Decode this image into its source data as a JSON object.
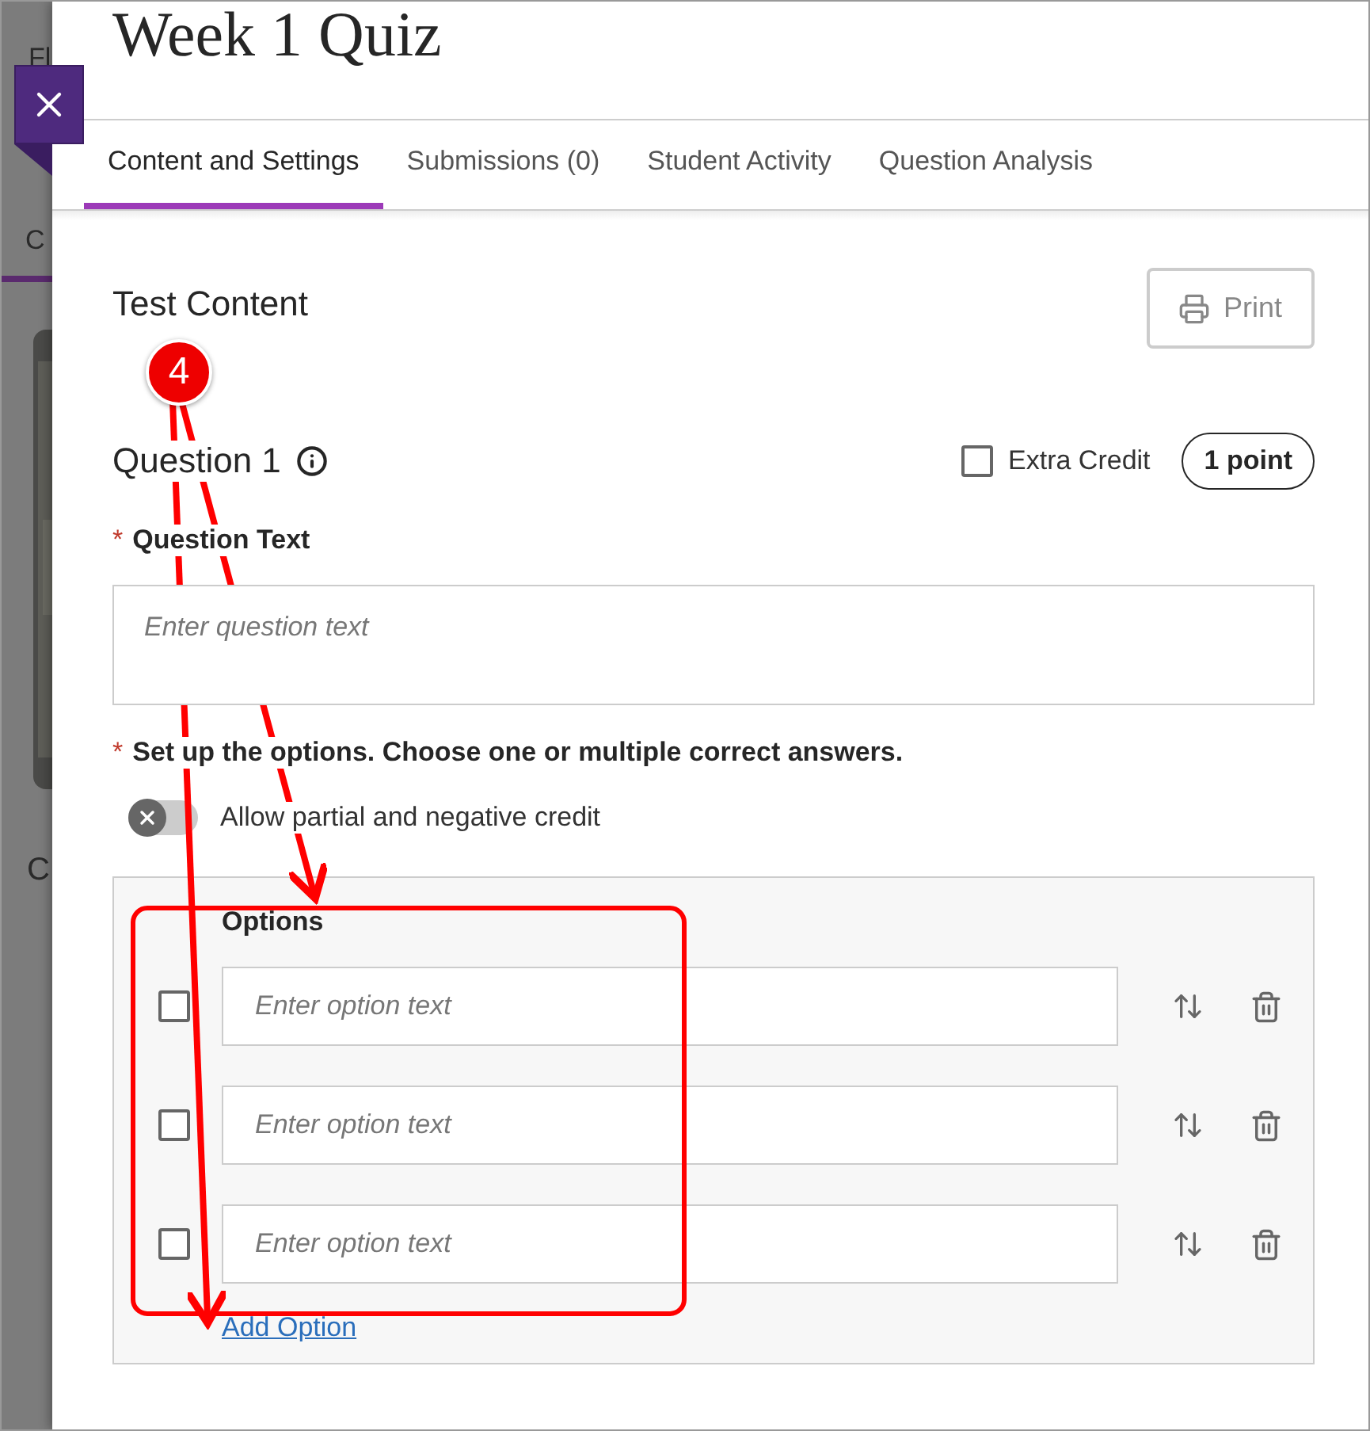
{
  "background_texts": [
    "Fl",
    "C",
    "C"
  ],
  "title": "Week 1 Quiz",
  "tabs": [
    {
      "label": "Content and Settings",
      "selected": true
    },
    {
      "label": "Submissions (0)",
      "selected": false
    },
    {
      "label": "Student Activity",
      "selected": false
    },
    {
      "label": "Question Analysis",
      "selected": false
    }
  ],
  "section_title": "Test Content",
  "print_button": {
    "label": "Print"
  },
  "question": {
    "title": "Question 1",
    "extra_credit": {
      "label": "Extra Credit",
      "checked": false
    },
    "points": "1 point"
  },
  "question_text": {
    "required_mark": "*",
    "label": "Question Text",
    "placeholder": "Enter question text"
  },
  "options_prompt": {
    "required_mark": "*",
    "label": "Set up the options. Choose one or multiple correct answers."
  },
  "partial_credit": {
    "label": "Allow partial and negative credit",
    "on": false
  },
  "options": {
    "heading": "Options",
    "items": [
      {
        "placeholder": "Enter option text",
        "checked": false
      },
      {
        "placeholder": "Enter option text",
        "checked": false
      },
      {
        "placeholder": "Enter option text",
        "checked": false
      }
    ],
    "add_link": "Add Option"
  },
  "annotation": {
    "callout": "4"
  }
}
